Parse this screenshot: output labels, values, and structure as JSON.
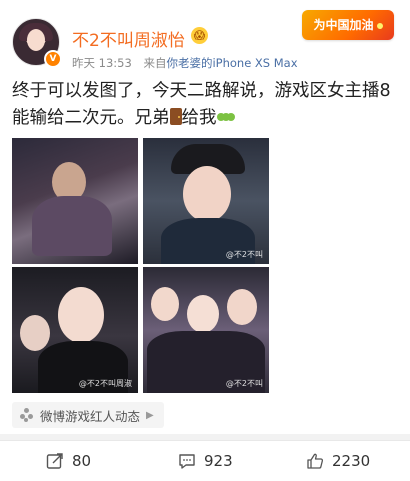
{
  "post": {
    "username": "不2不叫周淑怡",
    "time": "昨天 13:53",
    "source_prefix": "来自",
    "source": "你老婆的iPhone XS Max",
    "promo_tag": "为中国加油",
    "text_part1": "终于可以发图了，今天二路解说，游戏区女主播8能输给二次元。兄弟",
    "text_part2": "给我",
    "door_icon": "door-emoji-icon",
    "caterpillar_icon": "caterpillar-emoji-icon",
    "verified_icon": "verified-v-icon",
    "emoji_badge_icon": "fear-face-icon"
  },
  "photos": [
    {
      "watermark": ""
    },
    {
      "watermark": "@不2不叫"
    },
    {
      "watermark": "@不2不叫周淑"
    },
    {
      "watermark": "@不2不叫"
    }
  ],
  "topic": {
    "label": "微博游戏红人动态",
    "icon": "topic-icon"
  },
  "actions": {
    "repost_count": "80",
    "comment_count": "923",
    "like_count": "2230"
  },
  "colors": {
    "username": "#f36c21",
    "source_link": "#4a6fa5",
    "background": "#f2f2f2"
  }
}
